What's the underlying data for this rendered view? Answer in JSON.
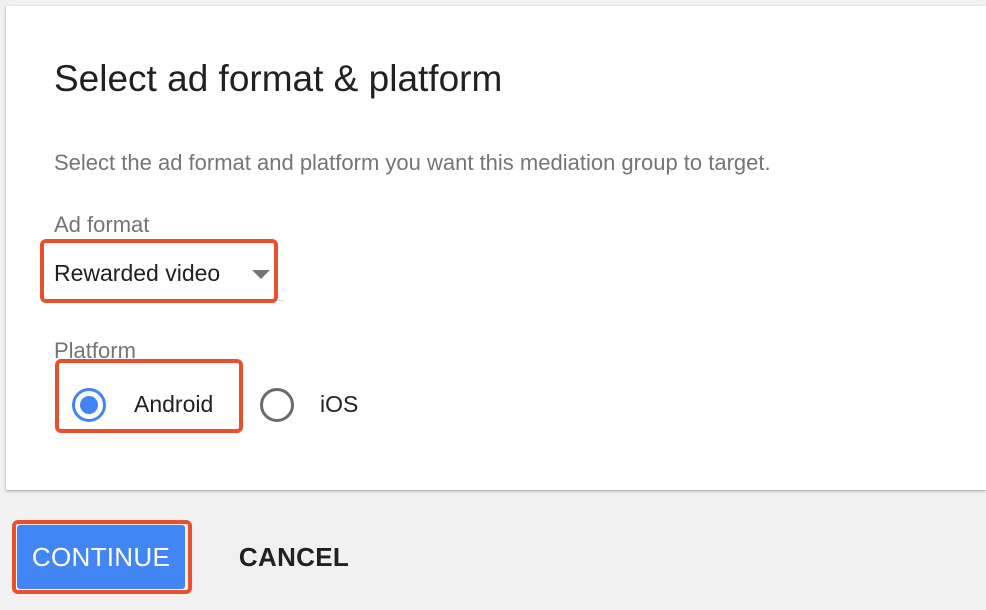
{
  "dialog": {
    "title": "Select ad format & platform",
    "description": "Select the ad format and platform you want this mediation group to target."
  },
  "ad_format": {
    "label": "Ad format",
    "selected": "Rewarded video",
    "icon": "dropdown-arrow-icon"
  },
  "platform": {
    "label": "Platform",
    "options": [
      {
        "label": "Android",
        "checked": true
      },
      {
        "label": "iOS",
        "checked": false
      }
    ]
  },
  "actions": {
    "continue_label": "CONTINUE",
    "cancel_label": "CANCEL"
  },
  "colors": {
    "accent": "#4285f4",
    "highlight": "#e8512c",
    "background": "#f1f1f1",
    "card": "#ffffff"
  }
}
